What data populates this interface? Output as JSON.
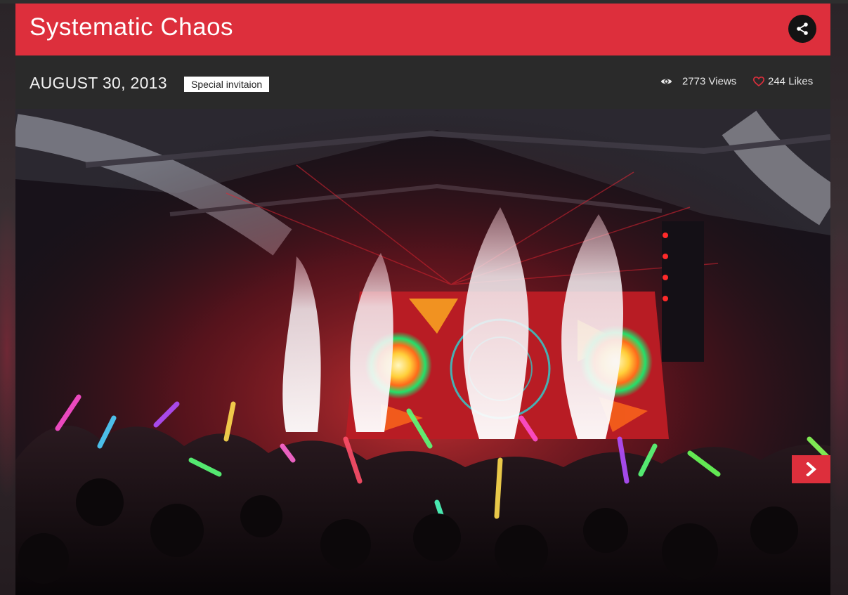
{
  "event": {
    "title": "Systematic Chaos",
    "date": "AUGUST 30, 2013",
    "tag": "Special invitaion",
    "views": "2773 Views",
    "likes": "244 Likes"
  },
  "icons": {
    "share": "share-icon",
    "views": "eye-icon",
    "likes": "heart-outline-icon",
    "next": "chevron-right-icon"
  },
  "colors": {
    "accent": "#dd2f3c",
    "meta_bar": "#2a2a2a",
    "share_button": "#131313",
    "heart": "#dd2f3c"
  },
  "photo": {
    "subject": "concert"
  }
}
